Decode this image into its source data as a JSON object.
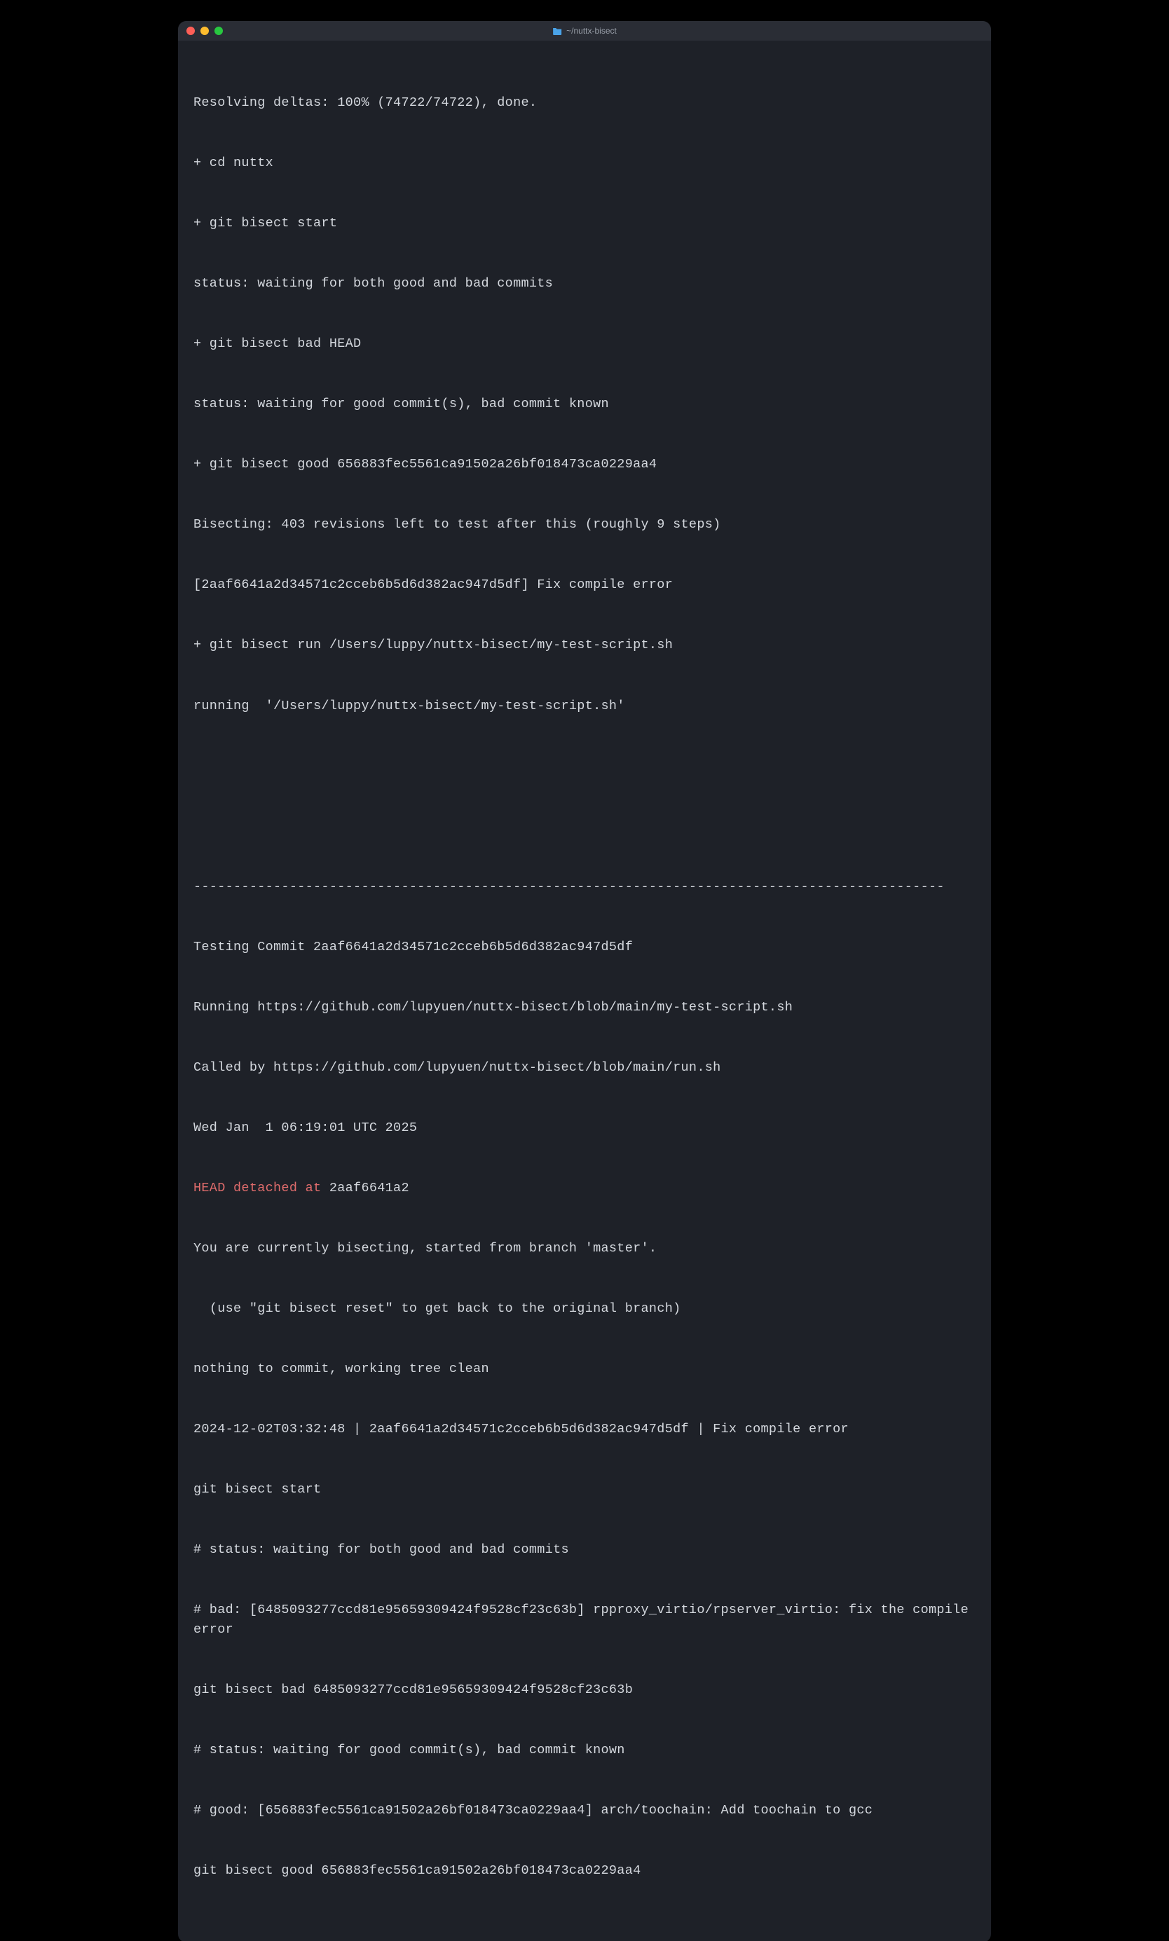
{
  "window": {
    "title": "~/nuttx-bisect"
  },
  "terminal": {
    "lines": [
      {
        "text": "Resolving deltas: 100% (74722/74722), done.",
        "color": "default"
      },
      {
        "text": "+ cd nuttx",
        "color": "default"
      },
      {
        "text": "+ git bisect start",
        "color": "default"
      },
      {
        "text": "status: waiting for both good and bad commits",
        "color": "default"
      },
      {
        "text": "+ git bisect bad HEAD",
        "color": "default"
      },
      {
        "text": "status: waiting for good commit(s), bad commit known",
        "color": "default"
      },
      {
        "text": "+ git bisect good 656883fec5561ca91502a26bf018473ca0229aa4",
        "color": "default"
      },
      {
        "text": "Bisecting: 403 revisions left to test after this (roughly 9 steps)",
        "color": "default"
      },
      {
        "text": "[2aaf6641a2d34571c2cceb6b5d6d382ac947d5df] Fix compile error",
        "color": "default"
      },
      {
        "text": "+ git bisect run /Users/luppy/nuttx-bisect/my-test-script.sh",
        "color": "default"
      },
      {
        "text": "running  '/Users/luppy/nuttx-bisect/my-test-script.sh'",
        "color": "default"
      },
      {
        "text": "",
        "color": "default"
      },
      {
        "text": "",
        "color": "default"
      },
      {
        "text": "----------------------------------------------------------------------------------------------",
        "color": "default"
      },
      {
        "text": "Testing Commit 2aaf6641a2d34571c2cceb6b5d6d382ac947d5df",
        "color": "default"
      },
      {
        "text": "Running https://github.com/lupyuen/nuttx-bisect/blob/main/my-test-script.sh",
        "color": "default"
      },
      {
        "text": "Called by https://github.com/lupyuen/nuttx-bisect/blob/main/run.sh",
        "color": "default"
      },
      {
        "text": "Wed Jan  1 06:19:01 UTC 2025",
        "color": "default"
      },
      {
        "text": "",
        "color": "default"
      },
      {
        "text": "You are currently bisecting, started from branch 'master'.",
        "color": "default"
      },
      {
        "text": "  (use \"git bisect reset\" to get back to the original branch)",
        "color": "default"
      },
      {
        "text": "nothing to commit, working tree clean",
        "color": "default"
      },
      {
        "text": "2024-12-02T03:32:48 | 2aaf6641a2d34571c2cceb6b5d6d382ac947d5df | Fix compile error",
        "color": "default"
      },
      {
        "text": "git bisect start",
        "color": "default"
      },
      {
        "text": "# status: waiting for both good and bad commits",
        "color": "default"
      },
      {
        "text": "# bad: [6485093277ccd81e95659309424f9528cf23c63b] rpproxy_virtio/rpserver_virtio: fix the compile error",
        "color": "default"
      },
      {
        "text": "git bisect bad 6485093277ccd81e95659309424f9528cf23c63b",
        "color": "default"
      },
      {
        "text": "# status: waiting for good commit(s), bad commit known",
        "color": "default"
      },
      {
        "text": "# good: [656883fec5561ca91502a26bf018473ca0229aa4] arch/toochain: Add toochain to gcc",
        "color": "default"
      },
      {
        "text": "git bisect good 656883fec5561ca91502a26bf018473ca0229aa4",
        "color": "default"
      }
    ],
    "head_detached": {
      "prefix": "HEAD detached at ",
      "hash": "2aaf6641a2"
    }
  }
}
